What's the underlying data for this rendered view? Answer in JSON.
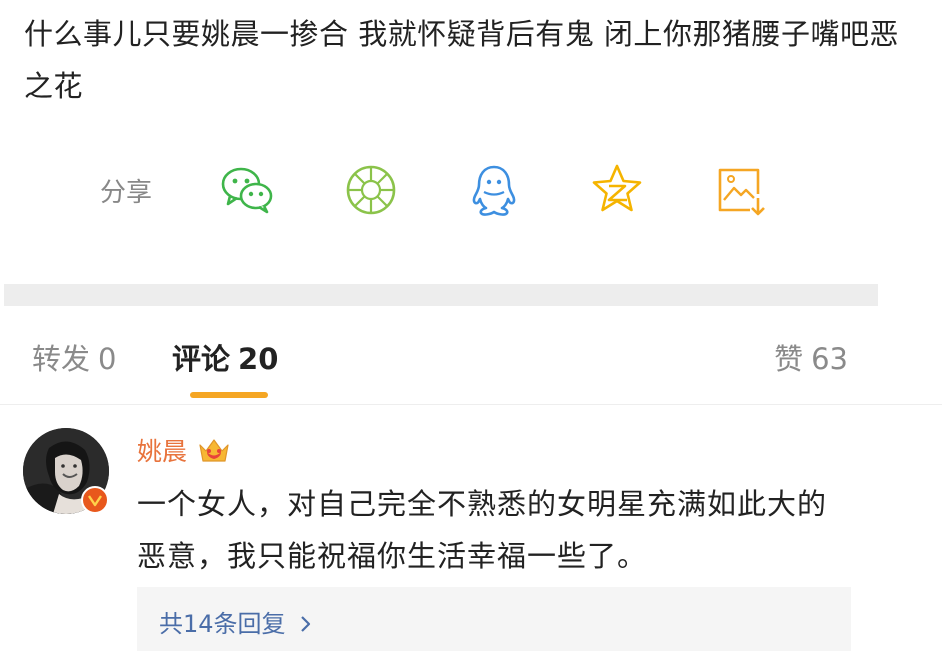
{
  "post": {
    "text": "什么事儿只要姚晨一掺合 我就怀疑背后有鬼 闭上你那猪腰子嘴吧恶之花"
  },
  "share": {
    "label": "分享",
    "icons": [
      "wechat-icon",
      "moments-icon",
      "qq-icon",
      "qzone-icon",
      "save-image-icon"
    ]
  },
  "tabs": {
    "repost_label": "转发",
    "repost_count": "0",
    "comments_label": "评论",
    "comments_count": "20",
    "likes_label": "赞",
    "likes_count": "63",
    "active": "comments"
  },
  "comment": {
    "username": "姚晨",
    "text": "一个女人，对自己完全不熟悉的女明星充满如此大的恶意，我只能祝福你生活幸福一些了。",
    "replies_label": "共14条回复"
  },
  "colors": {
    "accent": "#f5a623",
    "username": "#e8733c",
    "link": "#4a6da8",
    "wechat": "#3fb54a",
    "moments": "#8bc34a",
    "qq": "#3d8fe0",
    "qzone": "#f5b400",
    "save": "#f5a623"
  }
}
